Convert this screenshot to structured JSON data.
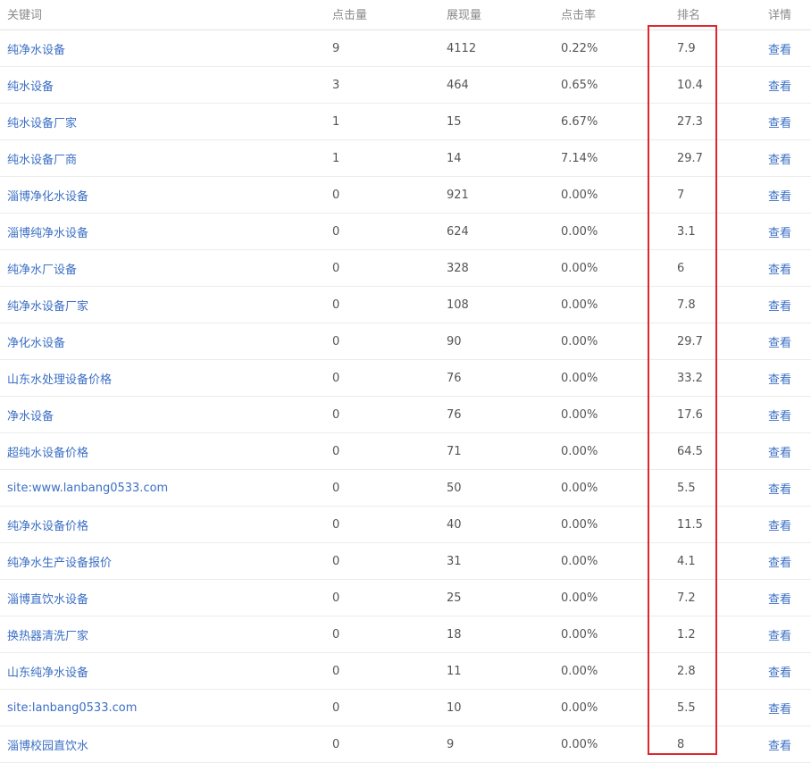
{
  "header": {
    "keyword": "关键词",
    "clicks": "点击量",
    "impressions": "展现量",
    "ctr": "点击率",
    "rank": "排名",
    "detail": "详情"
  },
  "highlight_color": "#e0252b",
  "link_color": "#3b6fc4",
  "rows": [
    {
      "keyword": "纯净水设备",
      "clicks": "9",
      "impressions": "4112",
      "ctr": "0.22%",
      "rank": "7.9",
      "detail": "查看"
    },
    {
      "keyword": "纯水设备",
      "clicks": "3",
      "impressions": "464",
      "ctr": "0.65%",
      "rank": "10.4",
      "detail": "查看"
    },
    {
      "keyword": "纯水设备厂家",
      "clicks": "1",
      "impressions": "15",
      "ctr": "6.67%",
      "rank": "27.3",
      "detail": "查看"
    },
    {
      "keyword": "纯水设备厂商",
      "clicks": "1",
      "impressions": "14",
      "ctr": "7.14%",
      "rank": "29.7",
      "detail": "查看"
    },
    {
      "keyword": "淄博净化水设备",
      "clicks": "0",
      "impressions": "921",
      "ctr": "0.00%",
      "rank": "7",
      "detail": "查看"
    },
    {
      "keyword": "淄博纯净水设备",
      "clicks": "0",
      "impressions": "624",
      "ctr": "0.00%",
      "rank": "3.1",
      "detail": "查看"
    },
    {
      "keyword": "纯净水厂设备",
      "clicks": "0",
      "impressions": "328",
      "ctr": "0.00%",
      "rank": "6",
      "detail": "查看"
    },
    {
      "keyword": "纯净水设备厂家",
      "clicks": "0",
      "impressions": "108",
      "ctr": "0.00%",
      "rank": "7.8",
      "detail": "查看"
    },
    {
      "keyword": "净化水设备",
      "clicks": "0",
      "impressions": "90",
      "ctr": "0.00%",
      "rank": "29.7",
      "detail": "查看"
    },
    {
      "keyword": "山东水处理设备价格",
      "clicks": "0",
      "impressions": "76",
      "ctr": "0.00%",
      "rank": "33.2",
      "detail": "查看"
    },
    {
      "keyword": "净水设备",
      "clicks": "0",
      "impressions": "76",
      "ctr": "0.00%",
      "rank": "17.6",
      "detail": "查看"
    },
    {
      "keyword": "超纯水设备价格",
      "clicks": "0",
      "impressions": "71",
      "ctr": "0.00%",
      "rank": "64.5",
      "detail": "查看"
    },
    {
      "keyword": "site:www.lanbang0533.com",
      "clicks": "0",
      "impressions": "50",
      "ctr": "0.00%",
      "rank": "5.5",
      "detail": "查看"
    },
    {
      "keyword": "纯净水设备价格",
      "clicks": "0",
      "impressions": "40",
      "ctr": "0.00%",
      "rank": "11.5",
      "detail": "查看"
    },
    {
      "keyword": "纯净水生产设备报价",
      "clicks": "0",
      "impressions": "31",
      "ctr": "0.00%",
      "rank": "4.1",
      "detail": "查看"
    },
    {
      "keyword": "淄博直饮水设备",
      "clicks": "0",
      "impressions": "25",
      "ctr": "0.00%",
      "rank": "7.2",
      "detail": "查看"
    },
    {
      "keyword": "换热器清洗厂家",
      "clicks": "0",
      "impressions": "18",
      "ctr": "0.00%",
      "rank": "1.2",
      "detail": "查看"
    },
    {
      "keyword": "山东纯净水设备",
      "clicks": "0",
      "impressions": "11",
      "ctr": "0.00%",
      "rank": "2.8",
      "detail": "查看"
    },
    {
      "keyword": "site:lanbang0533.com",
      "clicks": "0",
      "impressions": "10",
      "ctr": "0.00%",
      "rank": "5.5",
      "detail": "查看"
    },
    {
      "keyword": "淄博校园直饮水",
      "clicks": "0",
      "impressions": "9",
      "ctr": "0.00%",
      "rank": "8",
      "detail": "查看"
    }
  ]
}
